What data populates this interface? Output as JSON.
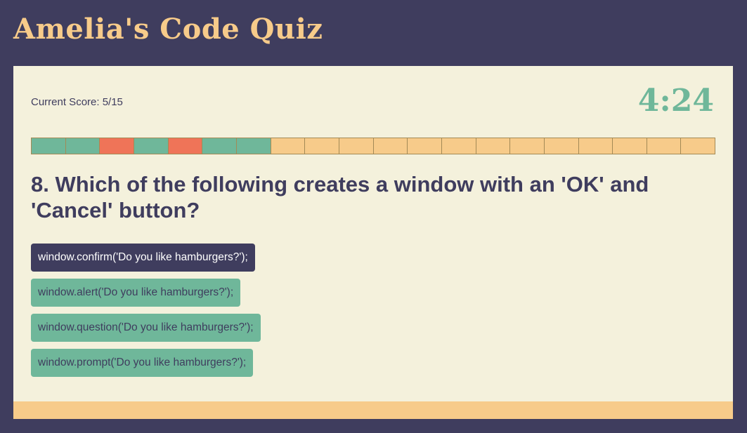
{
  "app": {
    "title": "Amelia's Code Quiz"
  },
  "status": {
    "score_label": "Current Score: 5/15",
    "timer": "4:24"
  },
  "progress": {
    "total": 20,
    "segments": [
      "correct",
      "correct",
      "wrong",
      "correct",
      "wrong",
      "correct",
      "correct",
      "pending",
      "pending",
      "pending",
      "pending",
      "pending",
      "pending",
      "pending",
      "pending",
      "pending",
      "pending",
      "pending",
      "pending",
      "pending"
    ]
  },
  "question": {
    "text": "8. Which of the following creates a window with an 'OK' and 'Cancel' button?",
    "answers": [
      {
        "label": "window.confirm('Do you like hamburgers?');",
        "selected": true
      },
      {
        "label": "window.alert('Do you like hamburgers?');",
        "selected": false
      },
      {
        "label": "window.question('Do you like hamburgers?');",
        "selected": false
      },
      {
        "label": "window.prompt('Do you like hamburgers?');",
        "selected": false
      }
    ]
  },
  "colors": {
    "background": "#3f3d5e",
    "panel": "#f4f1dc",
    "accent": "#f7cb8a",
    "correct": "#6fb79a",
    "wrong": "#ef7458"
  }
}
